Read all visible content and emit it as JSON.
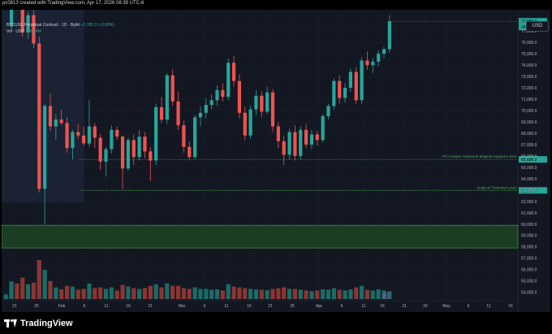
{
  "credit": "pc0813 created with TradingView.com, Apr 17, 2026 08:39 UTC-6",
  "legend": {
    "symbol": "BTCUSD Perpetual Contract · 1D · Bybit",
    "change": "+2,785.3 (+3.68%)",
    "volume_label": "Vol · USD",
    "volume_value": "188.24M"
  },
  "currency": "USD",
  "footer_logo_text": "TradingView",
  "colors": {
    "up": "#26a69a",
    "down": "#ef5350",
    "zone_border": "#4caf50",
    "zone_fill": "#1b3d21",
    "level_line": "#4caf50",
    "price_badge": "#26a69a"
  },
  "chart_data": {
    "type": "candlestick",
    "x_ticks": [
      "21",
      "26",
      "Feb",
      "6",
      "11",
      "16",
      "21",
      "Mar",
      "6",
      "11",
      "16",
      "21",
      "26",
      "Apr",
      "6",
      "11",
      "16",
      "21",
      "26",
      "May",
      "6",
      "11",
      "16"
    ],
    "y_ticks": [
      "54,000.0",
      "55,000.0",
      "56,000.0",
      "57,000.0",
      "58,000.0",
      "59,000.0",
      "60,000.0",
      "61,000.0",
      "62,000.0",
      "63,000.0",
      "64,000.0",
      "65,000.0",
      "66,000.0",
      "67,000.0",
      "68,000.0",
      "69,000.0",
      "70,000.0",
      "71,000.0",
      "72,000.0",
      "73,000.0",
      "74,000.0",
      "75,000.0",
      "76,000.0",
      "77,000.0"
    ],
    "ylim": [
      53400,
      78300
    ],
    "last_price": {
      "value": "77,859.3",
      "countdown": "09:20:29"
    },
    "levels": [
      {
        "label": "PC's Super Awesome Magical Support Level",
        "value": 65695.2,
        "badge": "65,695.2"
      },
      {
        "label": "Scalp w/ Potential Level",
        "value": 62967.4,
        "badge": "62,967.4"
      }
    ],
    "zone": {
      "low": 57900,
      "high": 59900
    },
    "candles": [
      [
        null,
        null,
        null,
        null,
        12
      ],
      [
        77400,
        80200,
        77000,
        79800,
        45
      ],
      [
        79800,
        80500,
        79000,
        79300,
        40
      ],
      [
        79300,
        79800,
        76500,
        76900,
        55
      ],
      [
        76900,
        78700,
        76300,
        78400,
        38
      ],
      [
        78400,
        78900,
        75500,
        75900,
        42
      ],
      [
        75900,
        76500,
        62800,
        63100,
        100
      ],
      [
        63100,
        70600,
        60000,
        70400,
        75
      ],
      [
        70400,
        71500,
        68200,
        68600,
        46
      ],
      [
        68600,
        69700,
        67400,
        69200,
        30
      ],
      [
        69200,
        70100,
        68700,
        68900,
        25
      ],
      [
        68900,
        69400,
        66300,
        66700,
        34
      ],
      [
        66700,
        68300,
        65700,
        68100,
        32
      ],
      [
        68100,
        68800,
        67500,
        67800,
        24
      ],
      [
        67800,
        68600,
        66900,
        67100,
        26
      ],
      [
        67100,
        70900,
        66800,
        68600,
        40
      ],
      [
        68600,
        68900,
        66700,
        67600,
        28
      ],
      [
        67600,
        67900,
        64800,
        65500,
        30
      ],
      [
        65500,
        66800,
        64200,
        66600,
        26
      ],
      [
        66600,
        68700,
        66200,
        68300,
        30
      ],
      [
        68300,
        68600,
        67400,
        67700,
        22
      ],
      [
        67700,
        67800,
        63100,
        64900,
        36
      ],
      [
        64900,
        67600,
        64700,
        67400,
        32
      ],
      [
        67400,
        67900,
        65200,
        65900,
        28
      ],
      [
        65900,
        68300,
        65600,
        67700,
        26
      ],
      [
        67700,
        68100,
        65800,
        66400,
        28
      ],
      [
        66400,
        66800,
        63800,
        65600,
        34
      ],
      [
        65600,
        70600,
        65200,
        70300,
        38
      ],
      [
        70300,
        71200,
        68900,
        69200,
        30
      ],
      [
        69200,
        73300,
        68800,
        73100,
        40
      ],
      [
        73100,
        73600,
        70400,
        70800,
        34
      ],
      [
        70800,
        71700,
        68300,
        68700,
        34
      ],
      [
        68700,
        69100,
        66300,
        66800,
        28
      ],
      [
        66800,
        67300,
        65600,
        65900,
        26
      ],
      [
        65900,
        69600,
        65700,
        69400,
        30
      ],
      [
        69400,
        70400,
        68600,
        69800,
        26
      ],
      [
        69800,
        71100,
        69300,
        70500,
        26
      ],
      [
        70500,
        71400,
        70100,
        70900,
        24
      ],
      [
        70900,
        72200,
        70400,
        71800,
        25
      ],
      [
        71800,
        72400,
        70800,
        71200,
        22
      ],
      [
        71200,
        74600,
        70900,
        74200,
        38
      ],
      [
        74200,
        74800,
        72100,
        72600,
        32
      ],
      [
        72600,
        73200,
        69300,
        69800,
        30
      ],
      [
        69800,
        70300,
        67400,
        67800,
        28
      ],
      [
        67800,
        70400,
        67500,
        70100,
        26
      ],
      [
        70100,
        71800,
        69600,
        71300,
        25
      ],
      [
        71300,
        71700,
        69400,
        69900,
        24
      ],
      [
        69900,
        72100,
        69700,
        71600,
        23
      ],
      [
        71600,
        71900,
        68100,
        68600,
        26
      ],
      [
        68600,
        69000,
        66700,
        67300,
        28
      ],
      [
        67300,
        67800,
        65200,
        66100,
        30
      ],
      [
        66100,
        68400,
        65700,
        68100,
        26
      ],
      [
        68100,
        68700,
        65600,
        66000,
        26
      ],
      [
        66000,
        68600,
        65700,
        68300,
        24
      ],
      [
        68300,
        68800,
        66700,
        67000,
        22
      ],
      [
        67000,
        68300,
        66600,
        67900,
        20
      ],
      [
        67900,
        68200,
        66900,
        67400,
        22
      ],
      [
        67400,
        69700,
        67200,
        69500,
        25
      ],
      [
        69500,
        70600,
        69200,
        70400,
        24
      ],
      [
        70400,
        72800,
        70100,
        72600,
        28
      ],
      [
        72600,
        73100,
        70600,
        71100,
        24
      ],
      [
        71100,
        72400,
        70700,
        72000,
        22
      ],
      [
        72000,
        73700,
        71600,
        73400,
        25
      ],
      [
        73400,
        73800,
        70600,
        70900,
        30
      ],
      [
        70900,
        74700,
        70600,
        74400,
        34
      ],
      [
        74400,
        75200,
        73600,
        74000,
        24
      ],
      [
        74000,
        74600,
        73300,
        74300,
        22
      ],
      [
        74300,
        75300,
        73900,
        75000,
        25
      ],
      [
        75000,
        75600,
        74600,
        75400,
        22
      ],
      [
        75400,
        78400,
        75100,
        77859,
        20
      ]
    ]
  }
}
